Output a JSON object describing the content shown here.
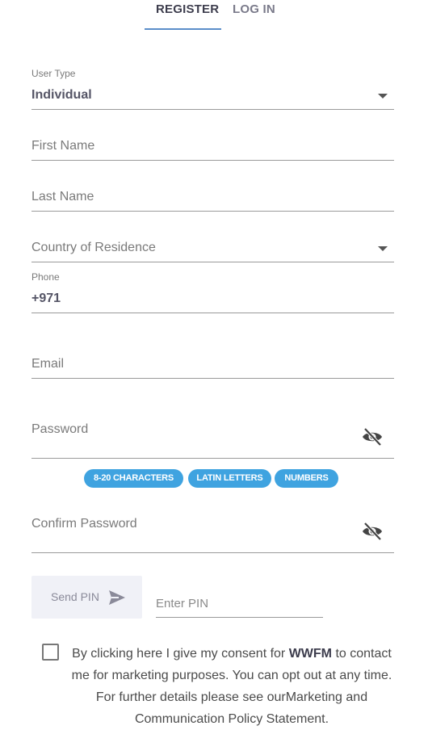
{
  "tabs": {
    "register": "REGISTER",
    "login": "LOG IN"
  },
  "form": {
    "user_type": {
      "label": "User Type",
      "value": "Individual"
    },
    "first_name": {
      "placeholder": "First Name"
    },
    "last_name": {
      "placeholder": "Last Name"
    },
    "country": {
      "placeholder": "Country of Residence"
    },
    "phone": {
      "label": "Phone",
      "value": "+971"
    },
    "email": {
      "placeholder": "Email"
    },
    "password": {
      "placeholder": "Password"
    },
    "password_rules": [
      "8-20 CHARACTERS",
      "LATIN LETTERS",
      "NUMBERS"
    ],
    "confirm_password": {
      "placeholder": "Confirm Password"
    },
    "send_pin_label": "Send PIN",
    "enter_pin_placeholder": "Enter PIN"
  },
  "consent": {
    "text_before": "By clicking here I give my consent for ",
    "brand": "WWFM",
    "text_after": " to contact me for marketing purposes. You can opt out at any time. For further details please see ourMarketing and Communication Policy Statement."
  },
  "colors": {
    "accent": "#3fa3e0",
    "tab_underline": "#5b8ec9",
    "button_bg": "#f0f1f7"
  }
}
